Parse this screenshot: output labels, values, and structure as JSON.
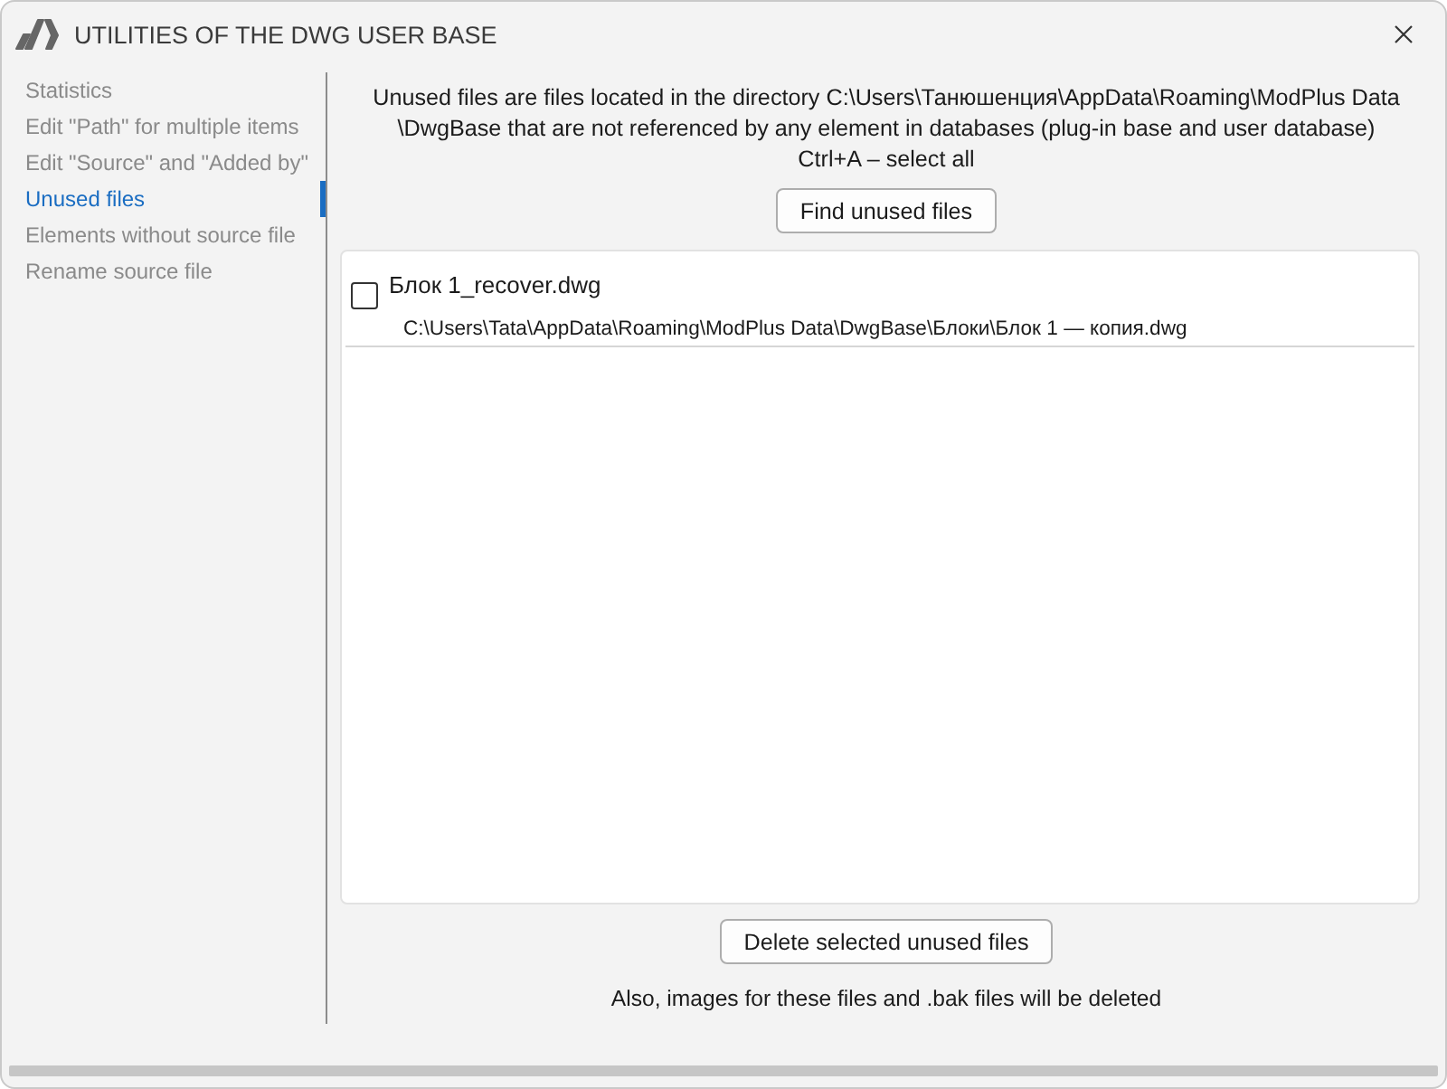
{
  "window": {
    "title": "UTILITIES OF THE DWG USER BASE"
  },
  "sidebar": {
    "items": [
      {
        "label": "Statistics",
        "selected": false
      },
      {
        "label": "Edit \"Path\" for multiple items",
        "selected": false
      },
      {
        "label": "Edit \"Source\" and \"Added by\"",
        "selected": false
      },
      {
        "label": "Unused files",
        "selected": true
      },
      {
        "label": "Elements without source file",
        "selected": false
      },
      {
        "label": "Rename source file",
        "selected": false
      }
    ]
  },
  "main": {
    "description": [
      "Unused files are files located in the directory C:\\Users\\Танюшенция\\AppData\\Roaming\\ModPlus Data",
      "\\DwgBase that are not referenced by any element in databases (plug-in base and user database)"
    ],
    "hint": "Ctrl+A – select all",
    "find_button": "Find unused files",
    "files": [
      {
        "name": "Блок 1_recover.dwg",
        "path": "C:\\Users\\Tata\\AppData\\Roaming\\ModPlus Data\\DwgBase\\Блоки\\Блок 1 — копия.dwg",
        "checked": false
      }
    ],
    "delete_button": "Delete selected unused files",
    "note": "Also, images for these files and .bak files will be deleted"
  }
}
